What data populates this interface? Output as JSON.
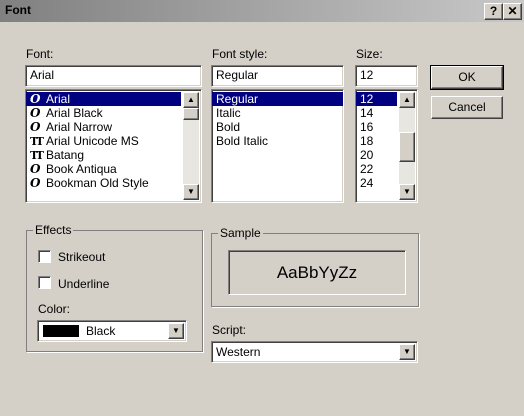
{
  "dialog": {
    "title": "Font",
    "help_label": "?",
    "close_label": "✕"
  },
  "font": {
    "label": "Font:",
    "value": "Arial",
    "items": [
      {
        "glyph": "O",
        "glyph_type": "opentype",
        "name": "Arial"
      },
      {
        "glyph": "O",
        "glyph_type": "opentype",
        "name": "Arial Black"
      },
      {
        "glyph": "O",
        "glyph_type": "opentype",
        "name": "Arial Narrow"
      },
      {
        "glyph": "TT",
        "glyph_type": "truetype",
        "name": "Arial Unicode MS"
      },
      {
        "glyph": "TT",
        "glyph_type": "truetype",
        "name": "Batang"
      },
      {
        "glyph": "O",
        "glyph_type": "opentype",
        "name": "Book Antiqua"
      },
      {
        "glyph": "O",
        "glyph_type": "opentype",
        "name": "Bookman Old Style"
      }
    ],
    "selected_index": 0
  },
  "style": {
    "label": "Font style:",
    "value": "Regular",
    "items": [
      "Regular",
      "Italic",
      "Bold",
      "Bold Italic"
    ],
    "selected_index": 0
  },
  "size": {
    "label": "Size:",
    "value": "12",
    "items": [
      "12",
      "14",
      "16",
      "18",
      "20",
      "22",
      "24"
    ],
    "selected_index": 0
  },
  "buttons": {
    "ok": "OK",
    "cancel": "Cancel"
  },
  "effects": {
    "title": "Effects",
    "strikeout_label": "Strikeout",
    "strikeout_checked": false,
    "underline_label": "Underline",
    "underline_checked": false,
    "color_label": "Color:",
    "color_value": "Black",
    "color_swatch": "#000000"
  },
  "sample": {
    "title": "Sample",
    "text": "AaBbYyZz"
  },
  "script": {
    "label": "Script:",
    "value": "Western"
  },
  "icons": {
    "scroll_up": "▲",
    "scroll_down": "▼",
    "dropdown": "▼"
  },
  "colors": {
    "selection": "#000080",
    "face": "#d4d0c8"
  }
}
